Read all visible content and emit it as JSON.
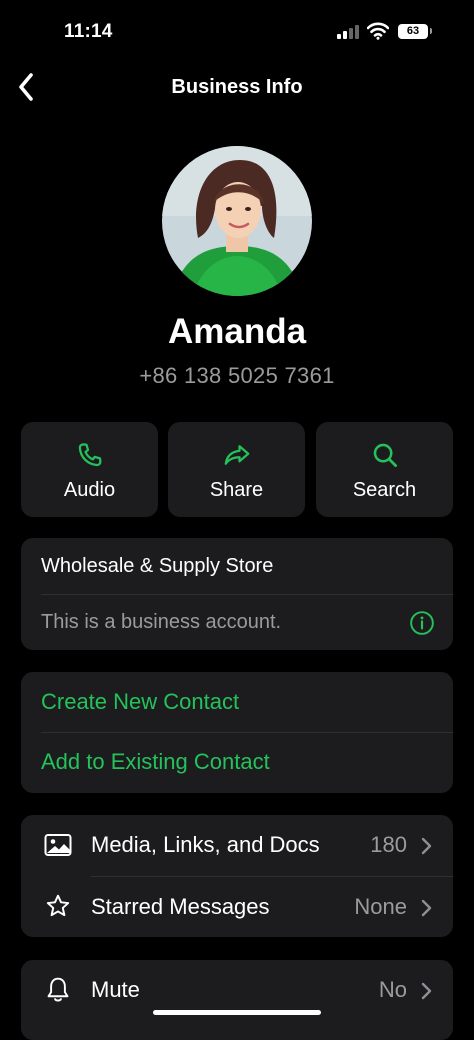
{
  "status_bar": {
    "time": "11:14",
    "battery": "63"
  },
  "nav": {
    "title": "Business Info"
  },
  "profile": {
    "name": "Amanda",
    "phone": "+86 138 5025 7361"
  },
  "actions": [
    {
      "label": "Audio",
      "icon": "phone-icon"
    },
    {
      "label": "Share",
      "icon": "share-arrow-icon"
    },
    {
      "label": "Search",
      "icon": "search-icon"
    }
  ],
  "business": {
    "category": "Wholesale & Supply Store",
    "note": "This is a business account."
  },
  "contact_options": {
    "create": "Create New Contact",
    "add_existing": "Add to Existing Contact"
  },
  "media_section": {
    "media": {
      "label": "Media, Links, and Docs",
      "value": "180"
    },
    "starred": {
      "label": "Starred Messages",
      "value": "None"
    }
  },
  "settings_section": {
    "mute": {
      "label": "Mute",
      "value": "No"
    }
  },
  "colors": {
    "accent": "#25c15b",
    "card": "#1c1c1e",
    "secondary_text": "#9b9b9b"
  }
}
